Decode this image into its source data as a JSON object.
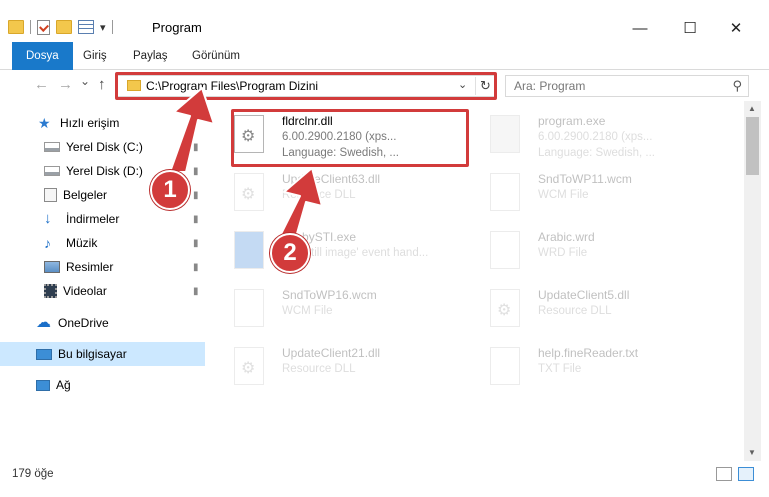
{
  "window": {
    "title": "Program",
    "minimize_glyph": "—",
    "maximize_glyph": "☐",
    "close_glyph": "✕"
  },
  "quick_access_toolbar": {
    "icons": [
      "folder-icon",
      "properties-check-icon",
      "new-folder-icon",
      "properties-icon"
    ],
    "dropdown_glyph": "▾"
  },
  "ribbon": {
    "tabs": [
      {
        "label": "Dosya",
        "active": true
      },
      {
        "label": "Giriş"
      },
      {
        "label": "Paylaş"
      },
      {
        "label": "Görünüm"
      }
    ]
  },
  "navigation": {
    "back_glyph": "←",
    "forward_glyph": "→",
    "recent_glyph": "⌄",
    "up_glyph": "↑",
    "address": "C:\\Program Files\\Program Dizini",
    "address_dropdown_glyph": "⌄",
    "refresh_glyph": "↻",
    "search_placeholder": "Ara: Program",
    "search_glyph": "⚲"
  },
  "sidebar": {
    "items": [
      {
        "label": "Hızlı erişim",
        "icon": "star-icon",
        "pinned": false
      },
      {
        "label": "Yerel Disk (C:)",
        "icon": "drive-icon",
        "pinned": true
      },
      {
        "label": "Yerel Disk (D:)",
        "icon": "drive-icon",
        "pinned": true
      },
      {
        "label": "Belgeler",
        "icon": "documents-icon",
        "pinned": true
      },
      {
        "label": "İndirmeler",
        "icon": "download-icon",
        "pinned": true
      },
      {
        "label": "Müzik",
        "icon": "music-icon",
        "pinned": true
      },
      {
        "label": "Resimler",
        "icon": "pictures-icon",
        "pinned": true
      },
      {
        "label": "Videolar",
        "icon": "videos-icon",
        "pinned": true
      },
      {
        "label": "OneDrive",
        "icon": "cloud-icon",
        "pinned": false
      },
      {
        "label": "Bu bilgisayar",
        "icon": "computer-icon",
        "pinned": false,
        "selected": true
      },
      {
        "label": "Ağ",
        "icon": "network-icon",
        "pinned": false
      }
    ],
    "pin_glyph": "📌"
  },
  "files": [
    {
      "name": "fldrclnr.dll",
      "line2": "6.00.2900.2180 (xps...",
      "line3": "Language: Swedish, ...",
      "highlighted": true
    },
    {
      "name": "program.exe",
      "line2": "6.00.2900.2180 (xps...",
      "line3": "Language: Swedish, ..."
    },
    {
      "name": "UpdateClient63.dll",
      "line2": "Resource DLL"
    },
    {
      "name": "SndToWP11.wcm",
      "line2": "WCM File"
    },
    {
      "name": "LobbySTI.exe",
      "line2": "STI 'still image' event hand..."
    },
    {
      "name": "Arabic.wrd",
      "line2": "WRD File"
    },
    {
      "name": "SndToWP16.wcm",
      "line2": "WCM File"
    },
    {
      "name": "UpdateClient5.dll",
      "line2": "Resource DLL"
    },
    {
      "name": "UpdateClient21.dll",
      "line2": "Resource DLL"
    },
    {
      "name": "help.fineReader.txt",
      "line2": "TXT File"
    }
  ],
  "annotations": {
    "step1": "1",
    "step2": "2",
    "color": "#d23b3b"
  },
  "status": {
    "item_count": "179 öğe"
  }
}
